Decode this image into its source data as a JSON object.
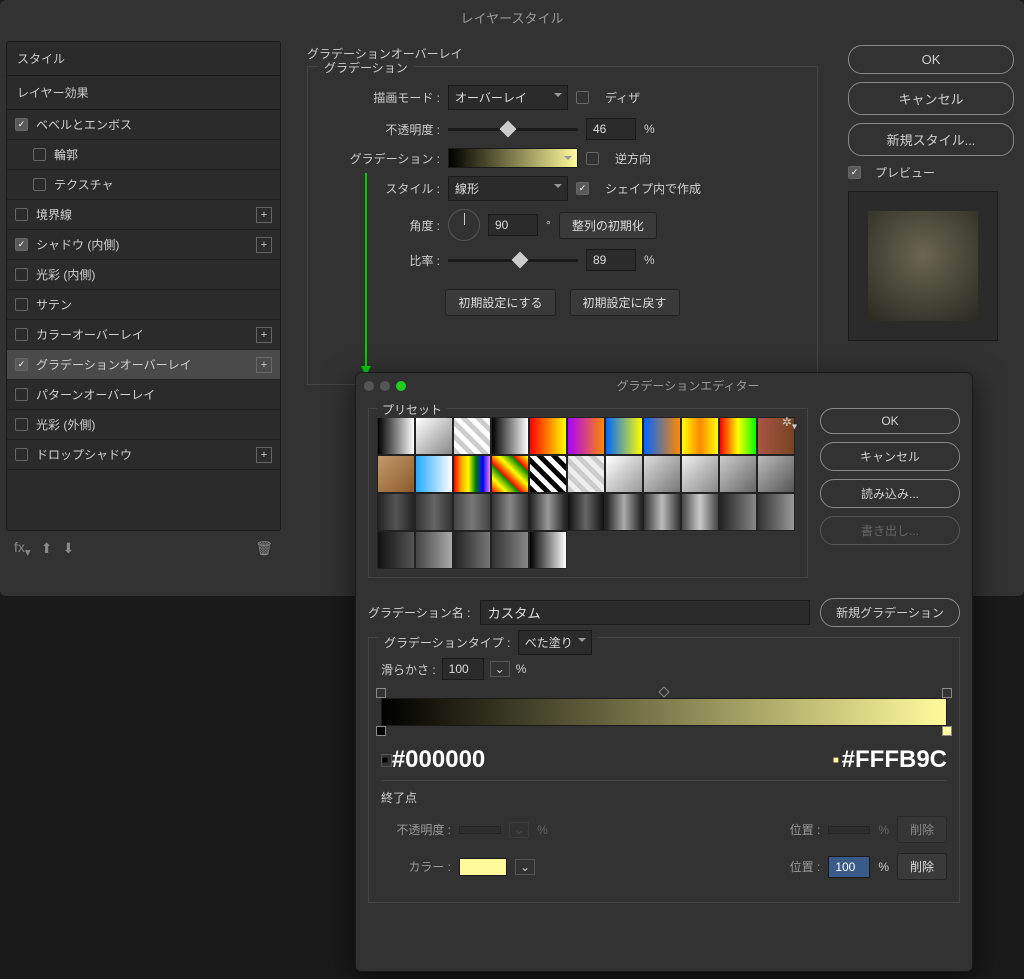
{
  "layerStyle": {
    "title": "レイヤースタイル",
    "stylesHeader": "スタイル",
    "effectsHeader": "レイヤー効果",
    "items": [
      {
        "label": "ベベルとエンボス",
        "checked": true,
        "hasPlus": false,
        "sub": false
      },
      {
        "label": "輪郭",
        "checked": false,
        "hasPlus": false,
        "sub": true
      },
      {
        "label": "テクスチャ",
        "checked": false,
        "hasPlus": false,
        "sub": true
      },
      {
        "label": "境界線",
        "checked": false,
        "hasPlus": true,
        "sub": false
      },
      {
        "label": "シャドウ (内側)",
        "checked": true,
        "hasPlus": true,
        "sub": false
      },
      {
        "label": "光彩 (内側)",
        "checked": false,
        "hasPlus": false,
        "sub": false
      },
      {
        "label": "サテン",
        "checked": false,
        "hasPlus": false,
        "sub": false
      },
      {
        "label": "カラーオーバーレイ",
        "checked": false,
        "hasPlus": true,
        "sub": false
      },
      {
        "label": "グラデーションオーバーレイ",
        "checked": true,
        "hasPlus": true,
        "sub": false,
        "selected": true
      },
      {
        "label": "パターンオーバーレイ",
        "checked": false,
        "hasPlus": false,
        "sub": false
      },
      {
        "label": "光彩 (外側)",
        "checked": false,
        "hasPlus": false,
        "sub": false
      },
      {
        "label": "ドロップシャドウ",
        "checked": false,
        "hasPlus": true,
        "sub": false
      }
    ],
    "fxLabel": "fx",
    "center": {
      "heading": "グラデーションオーバーレイ",
      "group": "グラデーション",
      "blendModeLabel": "描画モード :",
      "blendMode": "オーバーレイ",
      "ditherLabel": "ディザ",
      "opacityLabel": "不透明度 :",
      "opacityValue": "46",
      "percent": "%",
      "gradientLabel": "グラデーション :",
      "reverseLabel": "逆方向",
      "styleLabel": "スタイル :",
      "styleValue": "線形",
      "alignLabel": "シェイプ内で作成",
      "angleLabel": "角度 :",
      "angleValue": "90",
      "degree": "°",
      "resetAlign": "整列の初期化",
      "scaleLabel": "比率 :",
      "scaleValue": "89",
      "makeDefault": "初期設定にする",
      "resetDefault": "初期設定に戻す"
    },
    "right": {
      "ok": "OK",
      "cancel": "キャンセル",
      "newStyle": "新規スタイル...",
      "preview": "プレビュー"
    }
  },
  "gradEditor": {
    "title": "グラデーションエディター",
    "presetsLabel": "プリセット",
    "presets": [
      "linear-gradient(90deg,#000,#fff)",
      "linear-gradient(135deg,#fff,#888)",
      "repeating-linear-gradient(45deg,#ccc 0 5px,#fff 5px 10px)",
      "linear-gradient(90deg,#000,#fff)",
      "linear-gradient(90deg,red,yellow)",
      "linear-gradient(90deg,#a0f,#f80)",
      "linear-gradient(90deg,#06f,#ff0)",
      "linear-gradient(90deg,#06f,#f80)",
      "linear-gradient(90deg,#ff0,#f80,#ff0)",
      "linear-gradient(90deg,#f00,#ff0,#0f0)",
      "linear-gradient(90deg,#a54,#742)",
      "linear-gradient(135deg,#c49a6c,#8b5a2b)",
      "linear-gradient(90deg,#2af,#fff)",
      "linear-gradient(90deg,red,orange,yellow,green,blue,violet)",
      "repeating-linear-gradient(45deg,red,yellow,green 20px)",
      "repeating-linear-gradient(45deg,#000 0 5px,#fff 5px 10px)",
      "repeating-linear-gradient(45deg,#ccc 0 5px,#eee 5px 10px)",
      "linear-gradient(135deg,#fff,#999)",
      "linear-gradient(135deg,#ddd,#777)",
      "linear-gradient(135deg,#eee,#888)",
      "linear-gradient(135deg,#ccc,#666)",
      "linear-gradient(135deg,#bbb,#555)",
      "linear-gradient(90deg,#222,#555,#222)",
      "linear-gradient(90deg,#333,#666,#333)",
      "linear-gradient(90deg,#444,#777,#444)",
      "linear-gradient(90deg,#333,#888,#333)",
      "linear-gradient(90deg,#222,#999,#222)",
      "linear-gradient(90deg,#111,#666,#111)",
      "linear-gradient(90deg,#222,#aaa,#222)",
      "linear-gradient(90deg,#333,#bbb,#333)",
      "linear-gradient(90deg,#444,#ccc,#444)",
      "linear-gradient(90deg,#222,#888)",
      "linear-gradient(90deg,#333,#999)",
      "linear-gradient(90deg,#111,#555)",
      "linear-gradient(90deg,#444,#aaa)",
      "linear-gradient(90deg,#222,#777)",
      "linear-gradient(90deg,#333,#888)",
      "linear-gradient(90deg,#000,#fff)"
    ],
    "buttons": {
      "ok": "OK",
      "cancel": "キャンセル",
      "load": "読み込み...",
      "save": "書き出し..."
    },
    "nameLabel": "グラデーション名 :",
    "nameValue": "カスタム",
    "newGrad": "新規グラデーション",
    "typeLabel": "グラデーションタイプ :",
    "typeValue": "べた塗り",
    "smoothLabel": "滑らかさ :",
    "smoothValue": "100",
    "percent": "%",
    "stopLeft": "#000000",
    "stopRight": "#FFFB9C",
    "endpointLabel": "終了点",
    "opacityLabel": "不透明度 :",
    "positionLabel": "位置 :",
    "positionValue": "100",
    "colorLabel": "カラー :",
    "colorValue": "#FFFB9C",
    "delete": "削除"
  }
}
